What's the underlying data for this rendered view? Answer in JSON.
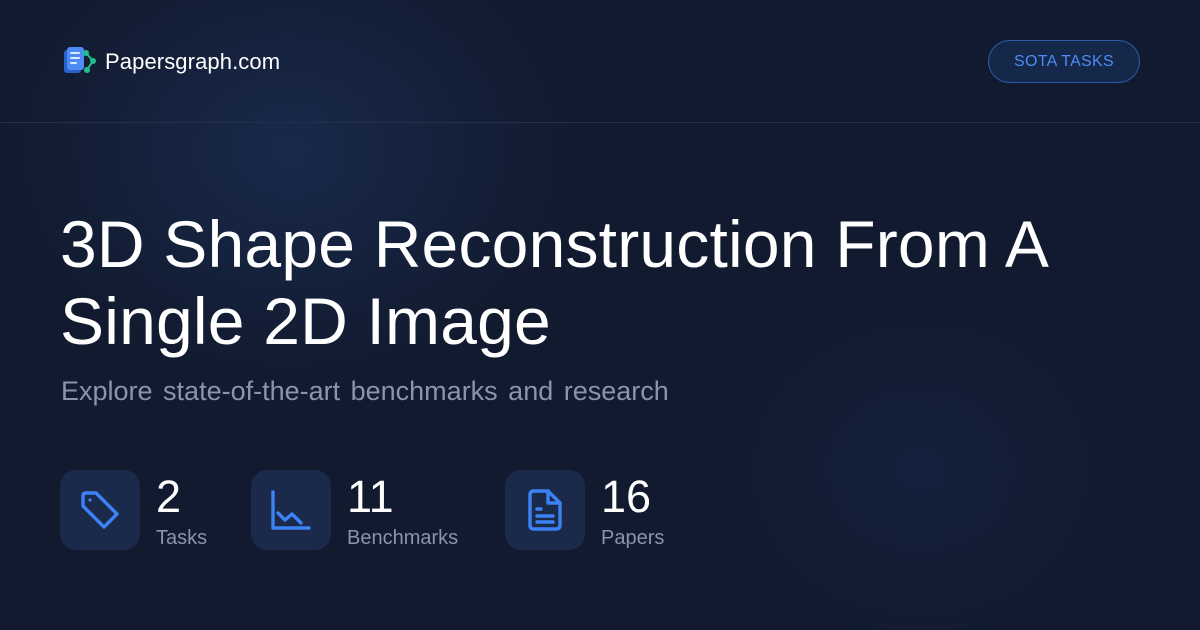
{
  "header": {
    "brand_name": "Papersgraph.com",
    "brand_icon": "papersgraph-logo-icon",
    "sota_button_label": "SOTA TASKS"
  },
  "main": {
    "title": "3D Shape Reconstruction  From A Single 2D Image",
    "subtitle": "Explore state-of-the-art benchmarks and research"
  },
  "stats": [
    {
      "value": "2",
      "label": "Tasks",
      "icon": "tag-icon"
    },
    {
      "value": "11",
      "label": "Benchmarks",
      "icon": "line-chart-icon"
    },
    {
      "value": "16",
      "label": "Papers",
      "icon": "document-icon"
    }
  ],
  "colors": {
    "background": "#111a2e",
    "accent": "#4d8cf5",
    "muted_text": "#8795ad",
    "icon_box": "#1b2a4a",
    "logo_green": "#21c08b"
  }
}
